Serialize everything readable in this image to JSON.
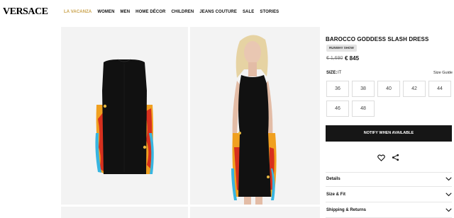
{
  "brand": {
    "logo": "VERSACE"
  },
  "nav": {
    "items": [
      "LA VACANZA",
      "WOMEN",
      "MEN",
      "HOME DÉCOR",
      "CHILDREN",
      "JEANS COUTURE",
      "SALE",
      "STORIES"
    ],
    "active_color": "#c9a14a"
  },
  "product": {
    "title": "BAROCCO GODDESS SLASH DRESS",
    "badge": "RUNWAY SHOW",
    "old_price": "€ 1,690",
    "price": "€ 845",
    "size_label": "SIZE:",
    "size_unit": "IT",
    "size_guide": "Size Guide",
    "sizes": [
      "36",
      "38",
      "40",
      "42",
      "44",
      "46",
      "48"
    ],
    "notify_label": "NOTIFY WHEN AVAILABLE"
  },
  "icons": {
    "wishlist": "heart-icon",
    "share": "share-icon",
    "accordion": "chevron-down-icon"
  },
  "accordion": [
    "Details",
    "Size & Fit",
    "Shipping & Returns"
  ],
  "colors": {
    "button": "#161616",
    "panel": "#f3f3f3"
  }
}
